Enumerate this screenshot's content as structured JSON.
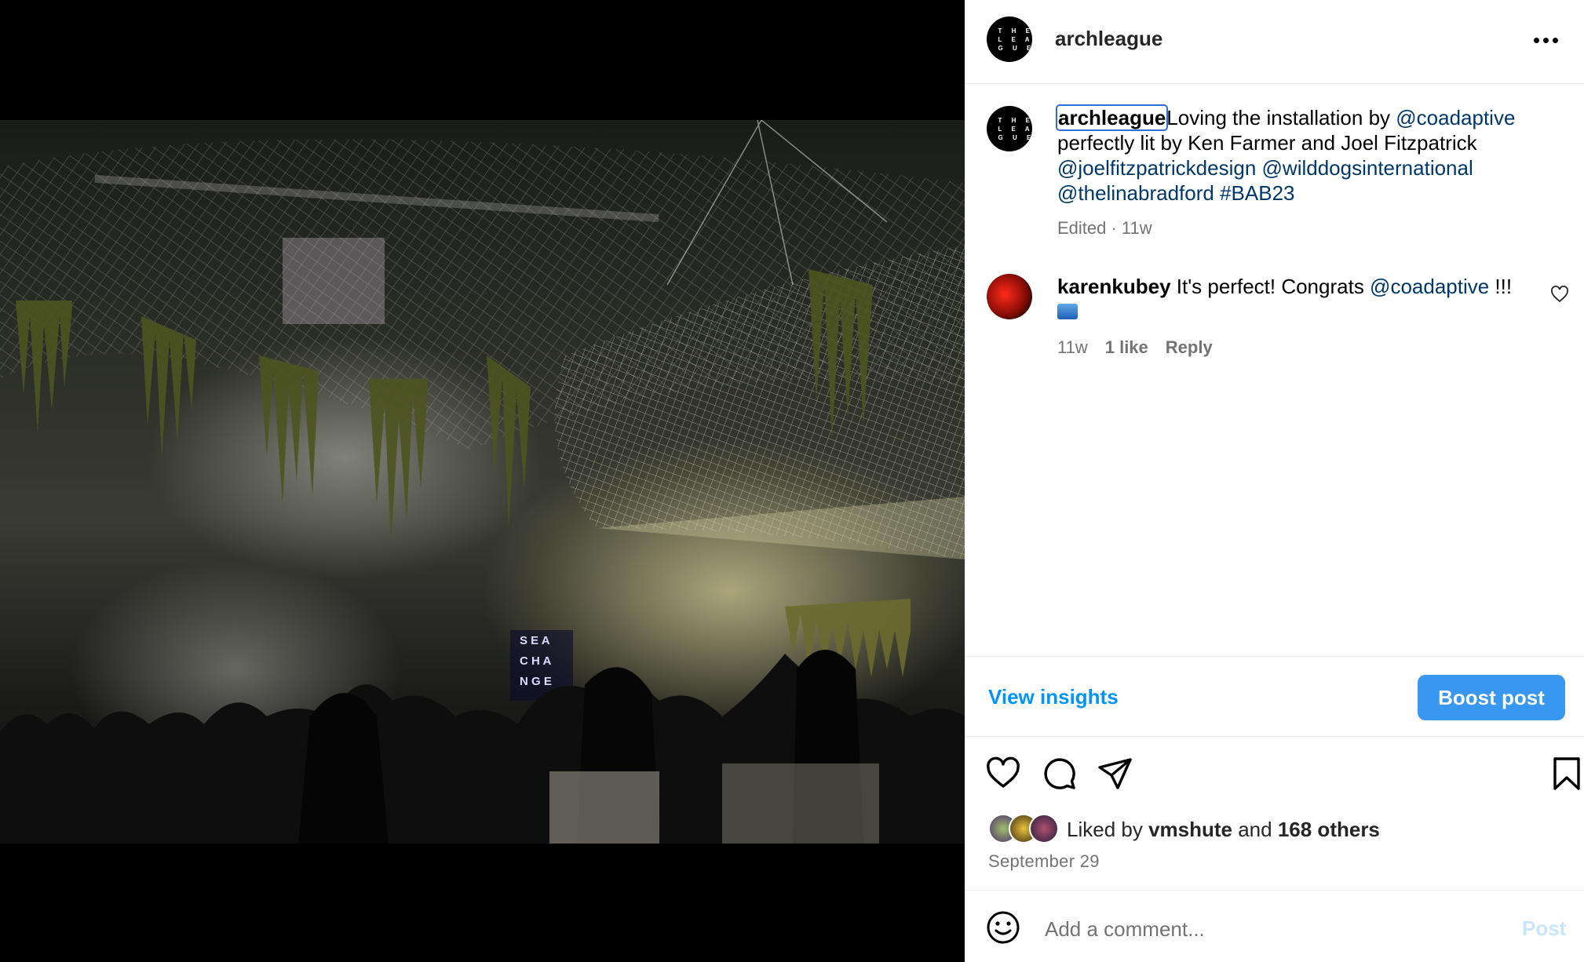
{
  "post": {
    "username": "archleague",
    "avatar_text": "T H E\nL E A\nG U E",
    "more_icon": "more-horizontal-icon"
  },
  "caption": {
    "username": "archleague",
    "text_1": "Loving the installation by ",
    "mention_1": "@coadaptive",
    "text_2": " perfectly lit by Ken Farmer and Joel Fitzpatrick ",
    "mention_2": "@joelfitzpatrickdesign",
    "mention_3": "@wilddogsinternational",
    "mention_4": "@thelinabradford",
    "hashtag": "#BAB23",
    "meta": "Edited · 11w"
  },
  "comment": {
    "username": "karenkubey",
    "text_1": " It's perfect! Congrats ",
    "mention": "@coadaptive",
    "text_2": " !!!",
    "emoji": "wave-emoji",
    "time": "11w",
    "likes": "1 like",
    "reply": "Reply"
  },
  "actions": {
    "view_insights": "View insights",
    "boost_post": "Boost post",
    "icons": [
      "heart-icon",
      "comment-icon",
      "share-icon",
      "bookmark-icon"
    ]
  },
  "likes": {
    "prefix": "Liked by ",
    "user": "vmshute",
    "middle": " and ",
    "others": "168 others"
  },
  "date": "September 29",
  "add_comment": {
    "placeholder": "Add a comment...",
    "post_label": "Post"
  },
  "colors": {
    "link": "#00376b",
    "accent": "#0095f6",
    "boost_bg": "#3897f0",
    "muted": "#737373"
  }
}
